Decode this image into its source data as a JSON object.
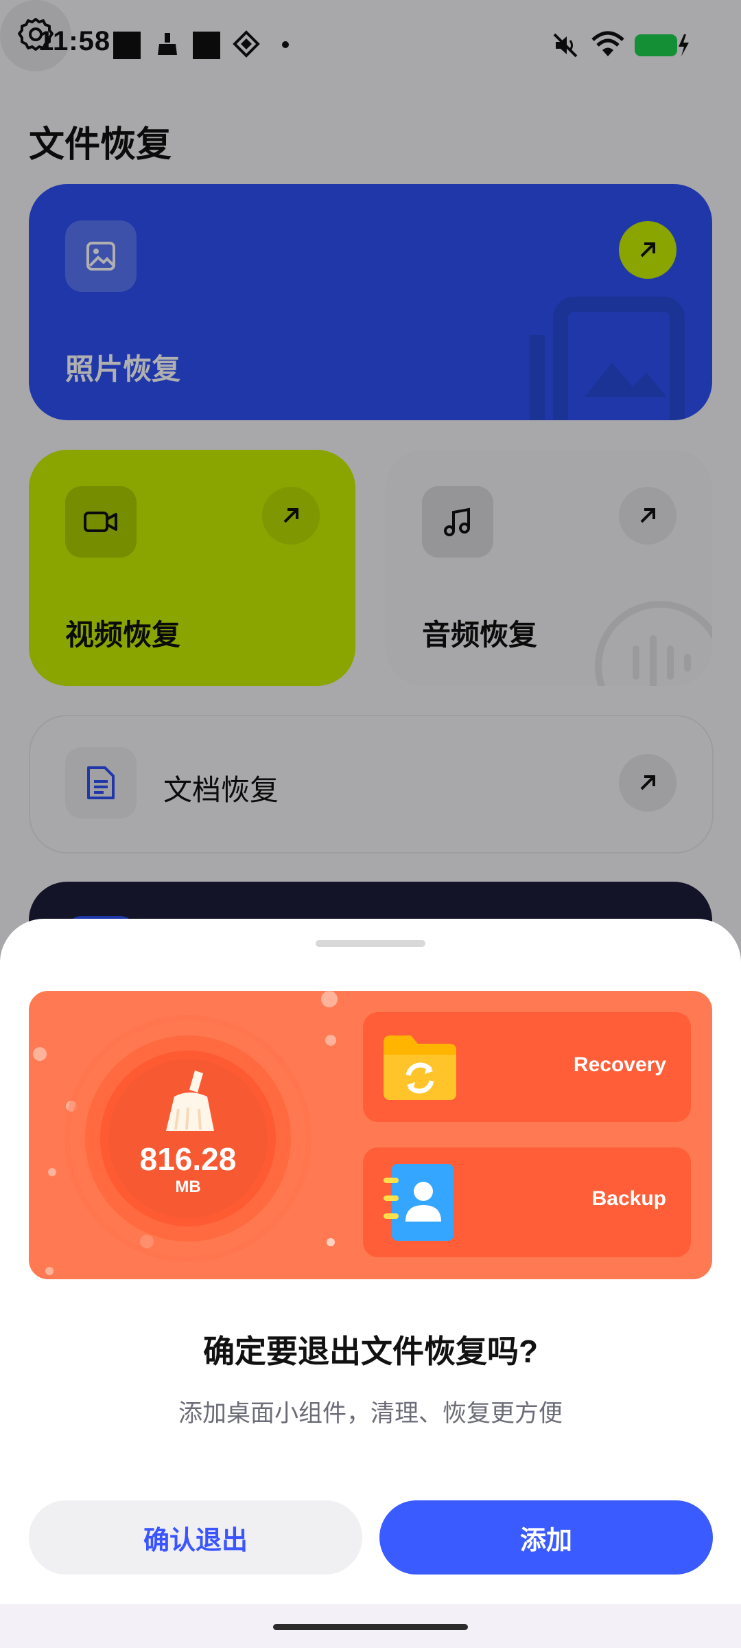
{
  "status_bar": {
    "time": "11:58",
    "icons": [
      "black-square-icon",
      "broom-notification-icon",
      "black-square-icon",
      "diamond-grid-icon",
      "dot-icon",
      "mute-icon",
      "wifi-icon",
      "battery-charging-icon"
    ],
    "battery_color": "#1ed04f"
  },
  "header": {
    "title": "文件恢复",
    "settings_icon": "gear-icon"
  },
  "cards": {
    "photo": {
      "label": "照片恢复",
      "icon": "image-icon",
      "color": "#2e50f5",
      "arrow_color": "#c8ee00"
    },
    "video": {
      "label": "视频恢复",
      "icon": "video-camera-icon",
      "color": "#c8ee00"
    },
    "audio": {
      "label": "音频恢复",
      "icon": "music-note-icon",
      "color": "#f1f1f3"
    },
    "document": {
      "label": "文档恢复",
      "icon": "document-icon",
      "icon_color": "#2e50f5"
    }
  },
  "sheet": {
    "banner": {
      "cleaned_size": "816.28",
      "cleaned_unit": "MB",
      "features": [
        {
          "label": "Recovery",
          "icon": "folder-sync-icon"
        },
        {
          "label": "Backup",
          "icon": "contact-book-icon"
        }
      ],
      "color": "#ff7a52"
    },
    "title": "确定要退出文件恢复吗?",
    "subtitle": "添加桌面小组件，清理、恢复更方便",
    "buttons": {
      "exit": "确认退出",
      "add": "添加"
    },
    "accent": "#3a5bff"
  }
}
